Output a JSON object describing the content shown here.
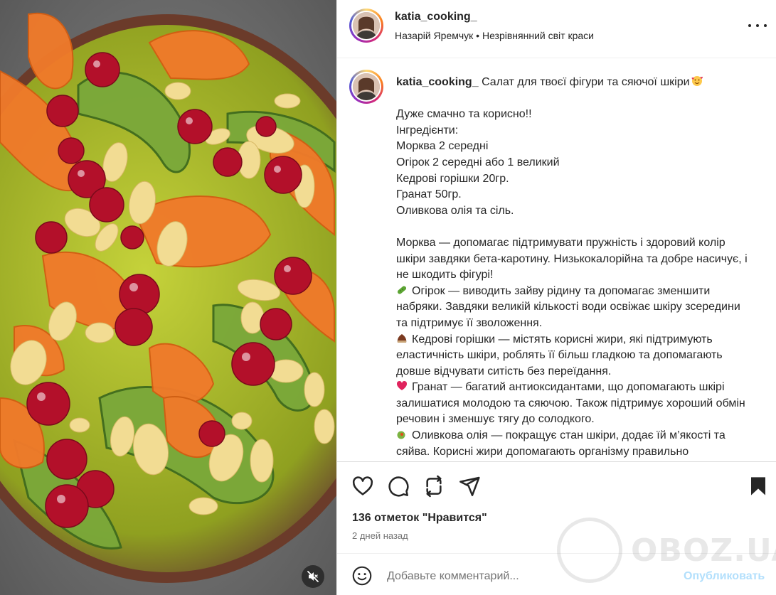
{
  "media": {
    "description_icon": "food-photo",
    "mute_icon": "speaker-muted-icon"
  },
  "header": {
    "username": "katia_cooking_",
    "subtitle": "Назарій Яремчук • Незрівнянний світ краси",
    "more_icon": "more-options-icon"
  },
  "caption": {
    "username": "katia_cooking_",
    "title": "Салат для твоєї фігури та сяючої шкіри",
    "title_emoji": "smiling-face-with-hearts-icon",
    "lines_1": [
      "Дуже смачно та корисно!!",
      "Інгредієнти:",
      "Морква 2 середні",
      "Огірок 2 середні або 1 великий",
      "Кедрові горішки 20гр.",
      "Гранат 50гр.",
      "Оливкова олія та сіль."
    ],
    "carrot": "Морква — допомагає підтримувати пружність і здоровий колір шкіри завдяки бета-каротину. Низькокалорійна та добре насичує, і не шкодить фігурі!",
    "cucumber": "Огірок — виводить зайву рідину та допомагає зменшити набряки. Завдяки великій кількості води освіжає шкіру зсередини та підтримує її зволоження.",
    "pine": "Кедрові горішки — містять корисні жири, які підтримують еластичність шкіри, роблять її більш гладкою та допомагають довше відчувати ситість без переїдання.",
    "pomegranate": "Гранат — багатий антиоксидантами, що допомагають шкірі залишатися молодою та сяючою. Також підтримує хороший обмін речовин і зменшує тягу до солодкого.",
    "olive": "Оливкова олія — покращує стан шкіри, додає їй м’якості та сяйва. Корисні жири допомагають організму правильно засвоювати вітаміни і підтримують відчуття ситості."
  },
  "actions": {
    "like_icon": "heart-icon",
    "comment_icon": "comment-bubble-icon",
    "repost_icon": "repost-icon",
    "share_icon": "share-send-icon",
    "save_icon": "bookmark-icon",
    "likes": "136 отметок \"Нравится\"",
    "time": "2 дней назад"
  },
  "comment": {
    "placeholder": "Добавьте комментарий...",
    "publish": "Опубликовать"
  },
  "watermark": {
    "text": "OBOZ.UA"
  },
  "colors": {
    "publish": "#b2dffc",
    "text": "#262626",
    "muted": "#737373"
  }
}
